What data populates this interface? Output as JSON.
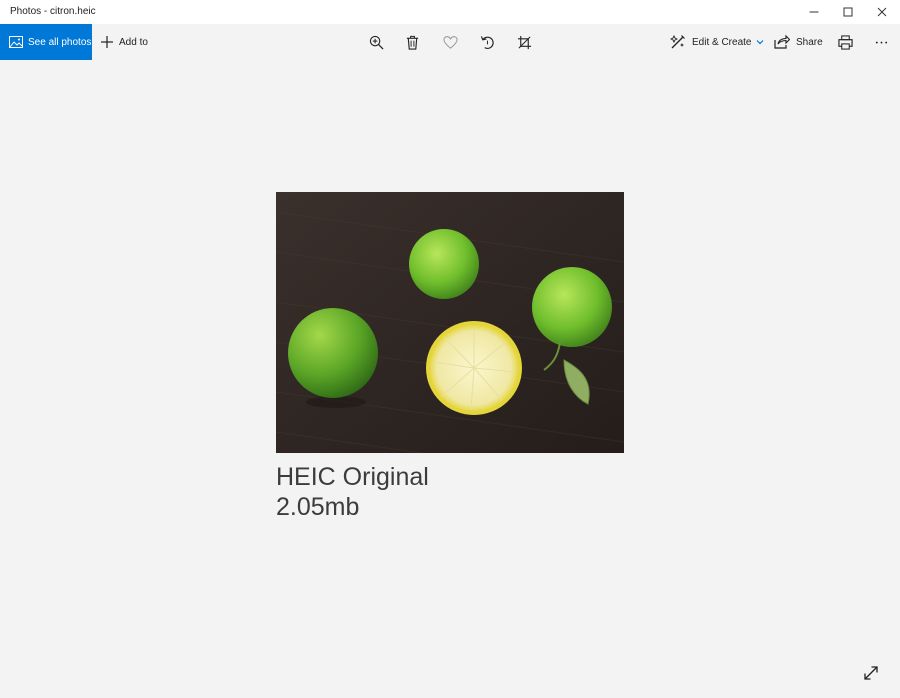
{
  "window": {
    "title": "Photos - citron.heic"
  },
  "toolbar": {
    "see_all_label": "See all photos",
    "add_to_label": "Add to",
    "edit_create_label": "Edit & Create",
    "share_label": "Share"
  },
  "photo": {
    "caption_line1": "HEIC Original",
    "caption_line2": "2.05mb"
  },
  "colors": {
    "accent": "#0078d7",
    "background": "#f3f3f3"
  },
  "icons": [
    "picture-icon",
    "plus-icon",
    "zoom-icon",
    "delete-icon",
    "favorite-icon",
    "rotate-icon",
    "crop-icon",
    "edit-create-icon",
    "share-icon",
    "print-icon",
    "more-icon",
    "expand-icon"
  ]
}
